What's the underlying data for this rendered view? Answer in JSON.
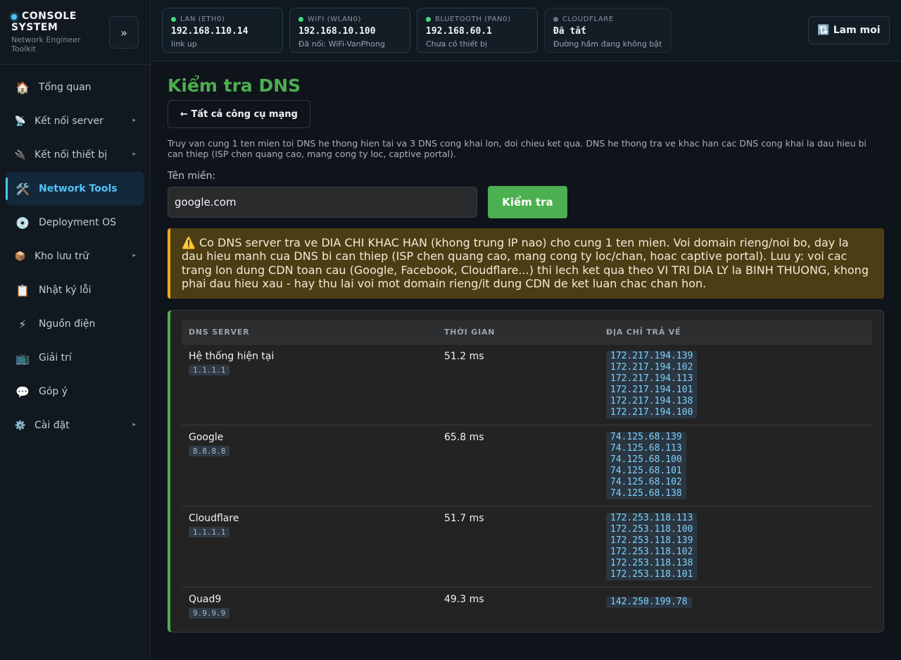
{
  "brand": {
    "title": "CONSOLE SYSTEM",
    "subtitle": "Network Engineer Toolkit",
    "collapse_label": "»"
  },
  "sidebar": {
    "items": [
      {
        "label": "Tổng quan",
        "icon": "🏠"
      },
      {
        "label": "Kết nối server",
        "icon": "📡"
      },
      {
        "label": "Kết nối thiết bị",
        "icon": "🔌"
      },
      {
        "label": "Network Tools",
        "icon": "🛠️"
      },
      {
        "label": "Deployment OS",
        "icon": "💿"
      },
      {
        "label": "Kho lưu trữ",
        "icon": "📦"
      },
      {
        "label": "Nhật ký lỗi",
        "icon": "📋"
      },
      {
        "label": "Nguồn điện",
        "icon": "⚡"
      },
      {
        "label": "Giải trí",
        "icon": "📺"
      },
      {
        "label": "Góp ý",
        "icon": "💬"
      },
      {
        "label": "Cài đặt",
        "icon": "⚙️"
      }
    ],
    "chevron": "▸"
  },
  "topbar": {
    "cards": [
      {
        "label": "LAN (ETH0)",
        "ip": "192.168.110.14",
        "sub": "link up"
      },
      {
        "label": "WIFI (WLAN0)",
        "ip": "192.168.10.100",
        "sub": "Đã nối: WiFi-VanPhong"
      },
      {
        "label": "BLUETOOTH (PAN0)",
        "ip": "192.168.60.1",
        "sub": "Chưa có thiết bị"
      },
      {
        "label": "CLOUDFLARE",
        "ip": "Đã tắt",
        "sub": "Đường hầm đang không bật"
      }
    ],
    "refresh_label": "🔃 Lam moi"
  },
  "main": {
    "title": "Kiểm tra DNS",
    "back_label": "← Tất cả công cụ mạng",
    "description": "Truy van cung 1 ten mien toi DNS he thong hien tai va 3 DNS cong khai lon, doi chieu ket qua. DNS he thong tra ve khac han cac DNS cong khai la dau hieu bi can thiep (ISP chen quang cao, mang cong ty loc, captive portal).",
    "domain_label": "Tên miền:",
    "domain_value": "google.com",
    "check_label": "Kiểm tra",
    "alert": "⚠️ Co DNS server tra ve DIA CHI KHAC HAN (khong trung IP nao) cho cung 1 ten mien. Voi domain rieng/noi bo, day la dau hieu manh cua DNS bi can thiep (ISP chen quang cao, mang cong ty loc/chan, hoac captive portal). Luu y: voi cac trang lon dung CDN toan cau (Google, Facebook, Cloudflare...) thi lech ket qua theo VI TRI DIA LY la BINH THUONG, khong phai dau hieu xau - hay thu lai voi mot domain rieng/it dung CDN de ket luan chac chan hon."
  },
  "results": {
    "headers": [
      "DNS SERVER",
      "THỜI GIAN",
      "ĐỊA CHỈ TRẢ VỀ"
    ],
    "rows": [
      {
        "name": "Hệ thống hiện tại",
        "server_ip": "1.1.1.1",
        "time": "51.2 ms",
        "addresses": [
          "172.217.194.139",
          "172.217.194.102",
          "172.217.194.113",
          "172.217.194.101",
          "172.217.194.138",
          "172.217.194.100"
        ]
      },
      {
        "name": "Google",
        "server_ip": "8.8.8.8",
        "time": "65.8 ms",
        "addresses": [
          "74.125.68.139",
          "74.125.68.113",
          "74.125.68.100",
          "74.125.68.101",
          "74.125.68.102",
          "74.125.68.138"
        ]
      },
      {
        "name": "Cloudflare",
        "server_ip": "1.1.1.1",
        "time": "51.7 ms",
        "addresses": [
          "172.253.118.113",
          "172.253.118.100",
          "172.253.118.139",
          "172.253.118.102",
          "172.253.118.138",
          "172.253.118.101"
        ]
      },
      {
        "name": "Quad9",
        "server_ip": "9.9.9.9",
        "time": "49.3 ms",
        "addresses": [
          "142.250.199.78"
        ]
      }
    ]
  },
  "colors": {
    "accent": "#4fc3f7",
    "success": "#4caf50",
    "warning": "#f5a623"
  }
}
